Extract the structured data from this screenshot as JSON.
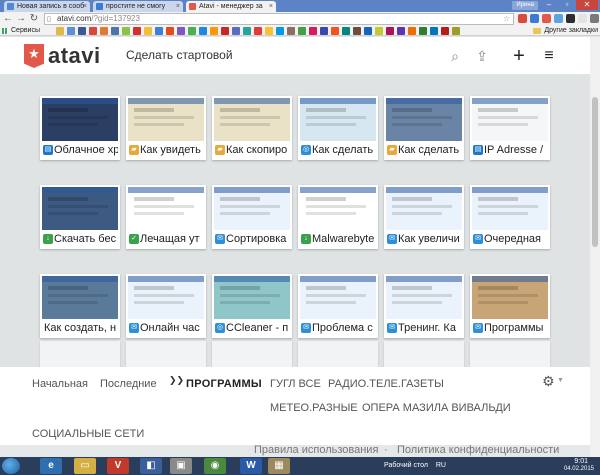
{
  "browser": {
    "tabs": [
      {
        "label": "Новая запись в сооб",
        "favicon_color": "#4e8ad6",
        "active": false
      },
      {
        "label": "простите не смогу",
        "favicon_color": "#3a7bd5",
        "active": false
      },
      {
        "label": "Atavi - менеджер за",
        "favicon_color": "#e2584a",
        "active": true
      }
    ],
    "window_user": "Ирина",
    "url_domain": "atavi.com",
    "url_path": "/?gid=137923",
    "bookmarks_apps": "Сервисы",
    "bookmarks_other": "Другие закладки"
  },
  "header": {
    "logo_text": "atavi",
    "make_start": "Сделать стартовой"
  },
  "tiles": [
    {
      "label": "Облачное хра",
      "icon": "doc-icon",
      "icon_color": "#1e78c8",
      "row": 0,
      "col": 0,
      "thumb": "#2a3f63"
    },
    {
      "label": "Как увидеть",
      "icon": "folder-icon",
      "icon_color": "#e6a93b",
      "row": 0,
      "col": 1,
      "thumb": "#e9e2c6"
    },
    {
      "label": "Как скопиро",
      "icon": "folder-icon",
      "icon_color": "#e6a93b",
      "row": 0,
      "col": 2,
      "thumb": "#e9e2c6"
    },
    {
      "label": "Как сделать",
      "icon": "globe-icon",
      "icon_color": "#2f8fd6",
      "row": 0,
      "col": 3,
      "thumb": "#d7e7f1"
    },
    {
      "label": "Как сделать",
      "icon": "folder-icon",
      "icon_color": "#e6a93b",
      "row": 0,
      "col": 4,
      "thumb": "#6a84a6"
    },
    {
      "label": "IP Adresse /",
      "icon": "doc-icon",
      "icon_color": "#1e78c8",
      "row": 0,
      "col": 5,
      "thumb": "#f4f6f8"
    },
    {
      "label": "Скачать бес",
      "icon": "download-icon",
      "icon_color": "#3aa24a",
      "row": 1,
      "col": 0,
      "thumb": "#3d5a82"
    },
    {
      "label": "Лечащая ут",
      "icon": "check-icon",
      "icon_color": "#3aa24a",
      "row": 1,
      "col": 1,
      "thumb": "#ffffff"
    },
    {
      "label": "Сортировка",
      "icon": "comment-icon",
      "icon_color": "#2f8fd6",
      "row": 1,
      "col": 2,
      "thumb": "#eaf2fb"
    },
    {
      "label": "Malwarebyte",
      "icon": "download-icon",
      "icon_color": "#3aa24a",
      "row": 1,
      "col": 3,
      "thumb": "#ffffff"
    },
    {
      "label": "Как увеличи",
      "icon": "comment-icon",
      "icon_color": "#2f8fd6",
      "row": 1,
      "col": 4,
      "thumb": "#eaf2fb"
    },
    {
      "label": "Очередная",
      "icon": "comment-icon",
      "icon_color": "#2f8fd6",
      "row": 1,
      "col": 5,
      "thumb": "#eaf2fb"
    },
    {
      "label": "Как создать, н",
      "icon": "",
      "icon_color": "",
      "row": 2,
      "col": 0,
      "thumb": "#5a7a9a"
    },
    {
      "label": "Онлайн час",
      "icon": "comment-icon",
      "icon_color": "#2f8fd6",
      "row": 2,
      "col": 1,
      "thumb": "#eaf2fb"
    },
    {
      "label": "CCleaner - п",
      "icon": "globe-icon",
      "icon_color": "#2f8fd6",
      "row": 2,
      "col": 2,
      "thumb": "#8fc6c8"
    },
    {
      "label": "Проблема с",
      "icon": "comment-icon",
      "icon_color": "#2f8fd6",
      "row": 2,
      "col": 3,
      "thumb": "#eaf2fb"
    },
    {
      "label": "Тренинг. Ка",
      "icon": "comment-icon",
      "icon_color": "#2f8fd6",
      "row": 2,
      "col": 4,
      "thumb": "#eaf2fb"
    },
    {
      "label": "Программы",
      "icon": "comment-icon",
      "icon_color": "#2f8fd6",
      "row": 2,
      "col": 5,
      "thumb": "#c7a577"
    }
  ],
  "categories": {
    "home": "Начальная",
    "recent": "Последние",
    "programs": "ПРОГРАММЫ",
    "google": "ГУГЛ ВСЕ",
    "radio": "РАДИО.ТЕЛЕ.ГАЗЕТЫ",
    "meteo": "МЕТЕО.РАЗНЫЕ",
    "opera": "ОПЕРА МАЗИЛА ВИВАЛЬДИ",
    "social": "СОЦИАЛЬНЫЕ СЕТИ"
  },
  "footer": {
    "terms": "Правила использования",
    "sep": "·",
    "privacy": "Политика конфиденциальности"
  },
  "taskbar": {
    "desktop_label": "Рабочий стол",
    "lang": "RU",
    "time": "9:01",
    "date": "04.02.2015"
  }
}
